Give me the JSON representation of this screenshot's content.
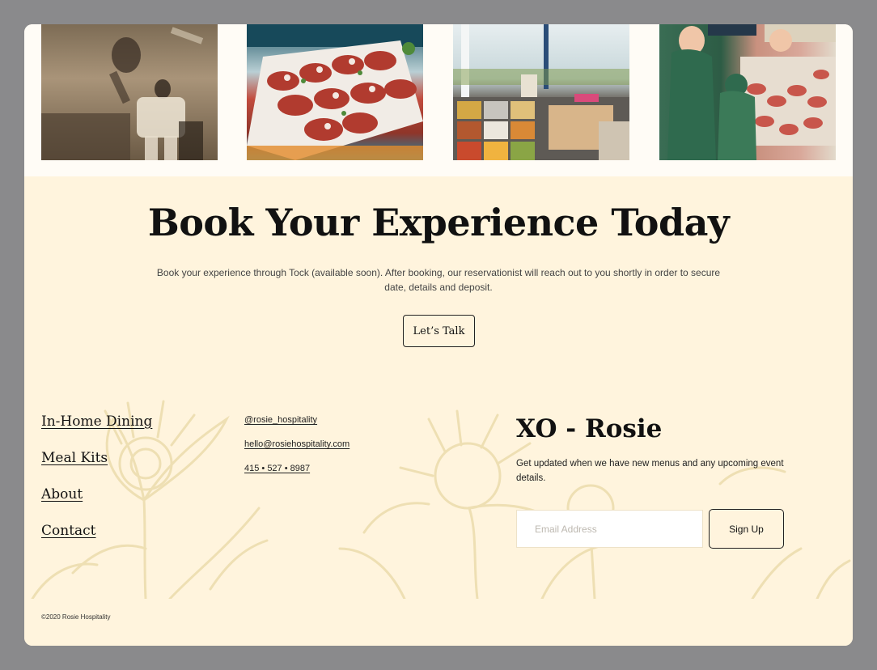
{
  "gallery": {
    "photos": [
      {
        "name": "vintage-acrobats-photo"
      },
      {
        "name": "bruschetta-platter-photo"
      },
      {
        "name": "food-prep-station-photo"
      },
      {
        "name": "vintage-butcher-shop-illustration"
      }
    ]
  },
  "booking": {
    "title": "Book Your Experience Today",
    "description_line1": "Book your experience through Tock (available soon). After booking, our reservationist will reach out to you shortly in order to secure",
    "description_line2": "date, details and deposit.",
    "cta_label": "Let’s Talk"
  },
  "footer": {
    "nav": [
      "In-Home Dining",
      "Meal Kits",
      "About",
      "Contact"
    ],
    "contact": {
      "instagram": "@rosie_hospitality",
      "email": "hello@rosiehospitality.com",
      "phone": "415 • 527 • 8987"
    },
    "newsletter": {
      "title": "XO - Rosie",
      "description_line1": "Get updated when we have new menus and any upcoming event",
      "description_line2": "details.",
      "email_placeholder": "Email Address",
      "signup_label": "Sign Up"
    },
    "copyright": "©2020 Rosie Hospitality"
  },
  "colors": {
    "backdrop": "#8a8a8c",
    "section_bg": "#fff4dd",
    "gallery_bg": "#fffcf6",
    "botanical_line": "#eedfb3",
    "text": "#111111"
  }
}
